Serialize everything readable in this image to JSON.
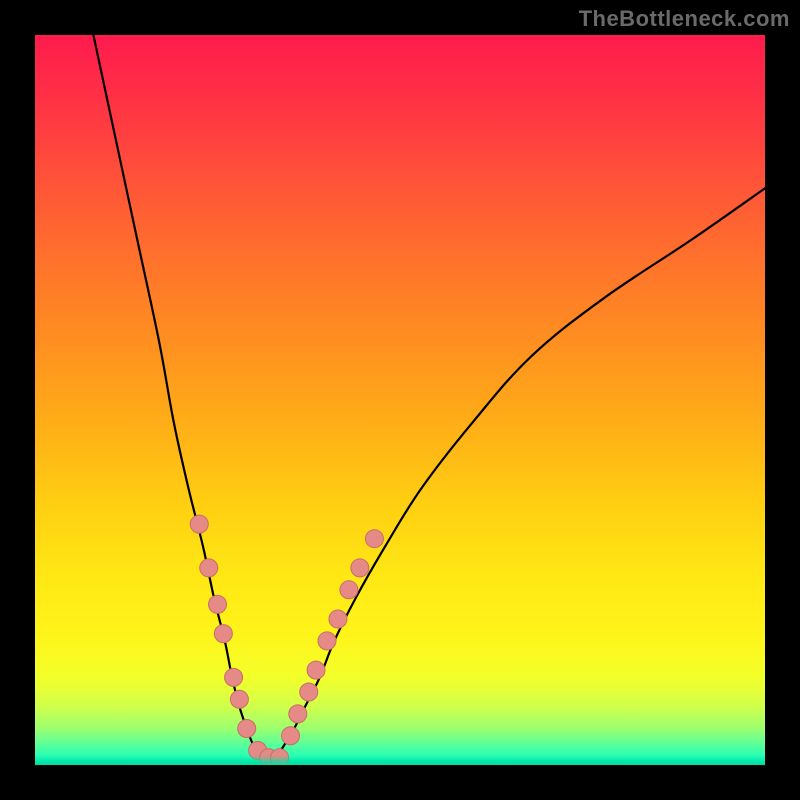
{
  "watermark": "TheBottleneck.com",
  "chart_data": {
    "type": "line",
    "title": "",
    "xlabel": "",
    "ylabel": "",
    "xlim": [
      0,
      100
    ],
    "ylim": [
      0,
      100
    ],
    "grid": false,
    "series": [
      {
        "name": "left-arm",
        "stroke": "#000000",
        "stroke_width": 2.2,
        "x": [
          8,
          11,
          14,
          17,
          19,
          21,
          23,
          24.5,
          26,
          27,
          28,
          29,
          30,
          31
        ],
        "y": [
          100,
          86,
          72,
          58,
          47,
          38,
          30,
          23,
          17,
          12,
          8,
          5,
          2.5,
          1
        ]
      },
      {
        "name": "right-arm",
        "stroke": "#000000",
        "stroke_width": 2.2,
        "x": [
          33,
          34,
          35.5,
          37,
          39,
          41,
          44,
          48,
          53,
          60,
          68,
          78,
          90,
          100
        ],
        "y": [
          1,
          2.5,
          5,
          8,
          12,
          17,
          23,
          30,
          38,
          47,
          56,
          64,
          72,
          79
        ]
      }
    ],
    "marker_series": [
      {
        "name": "left-arm-markers",
        "fill": "#e58a86",
        "stroke": "#c96d69",
        "r": 9,
        "points": [
          {
            "x": 22.5,
            "y": 33
          },
          {
            "x": 23.8,
            "y": 27
          },
          {
            "x": 25.0,
            "y": 22
          },
          {
            "x": 25.8,
            "y": 18
          },
          {
            "x": 27.2,
            "y": 12
          },
          {
            "x": 28.0,
            "y": 9
          },
          {
            "x": 29.0,
            "y": 5
          },
          {
            "x": 30.5,
            "y": 2
          },
          {
            "x": 32.0,
            "y": 1
          },
          {
            "x": 33.5,
            "y": 1
          }
        ]
      },
      {
        "name": "right-arm-markers",
        "fill": "#e58a86",
        "stroke": "#c96d69",
        "r": 9,
        "points": [
          {
            "x": 35.0,
            "y": 4
          },
          {
            "x": 36.0,
            "y": 7
          },
          {
            "x": 37.5,
            "y": 10
          },
          {
            "x": 38.5,
            "y": 13
          },
          {
            "x": 40.0,
            "y": 17
          },
          {
            "x": 41.5,
            "y": 20
          },
          {
            "x": 43.0,
            "y": 24
          },
          {
            "x": 44.5,
            "y": 27
          },
          {
            "x": 46.5,
            "y": 31
          }
        ]
      }
    ]
  }
}
